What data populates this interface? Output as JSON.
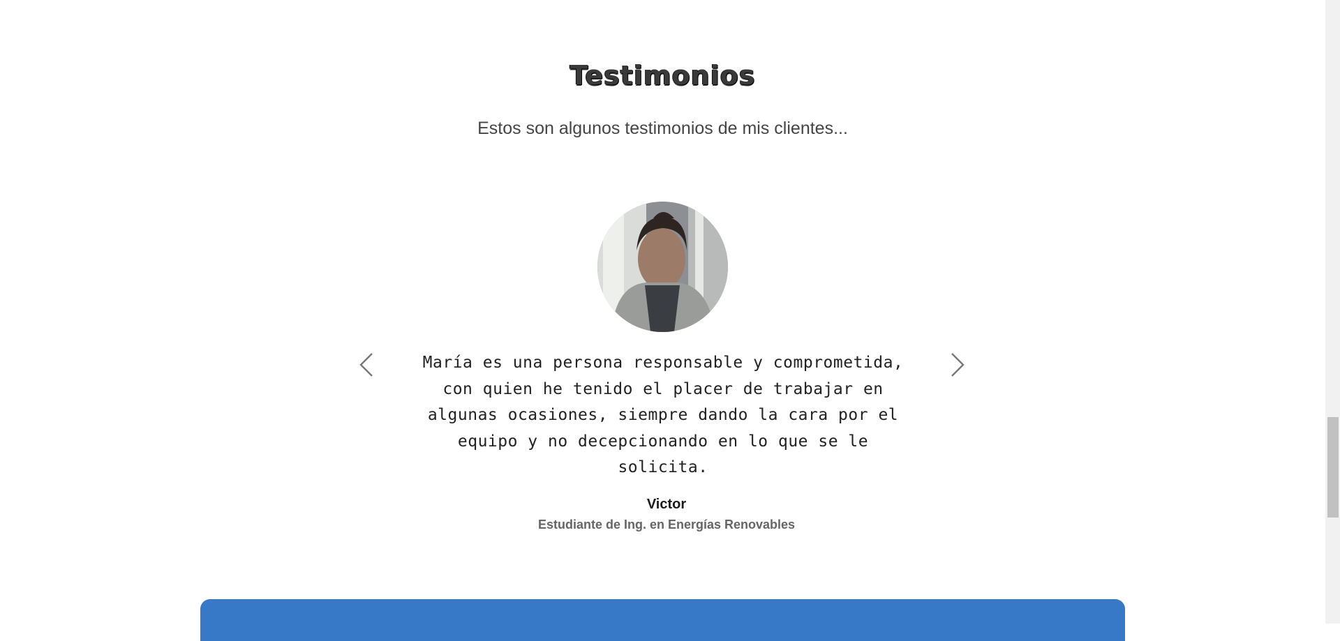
{
  "testimonials": {
    "title": "Testimonios",
    "subtitle": "Estos son algunos testimonios de mis clientes...",
    "current": {
      "quote": "María es una persona responsable y comprometida, con quien he tenido el placer de trabajar en algunas ocasiones, siempre dando la cara por el equipo y no decepcionando en lo que se le solicita.",
      "author_name": "Victor",
      "author_role": "Estudiante de Ing. en Energías Renovables"
    },
    "controls": {
      "prev_icon": "chevron-left-icon",
      "next_icon": "chevron-right-icon"
    }
  },
  "colors": {
    "panel": "#3779c7",
    "arrow": "#777777"
  }
}
